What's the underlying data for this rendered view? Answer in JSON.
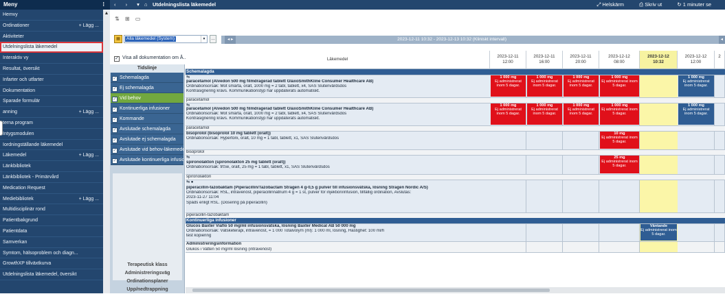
{
  "sidebar": {
    "header": "Meny",
    "items": [
      {
        "label": "Hemvy",
        "add": ""
      },
      {
        "label": "Ordinationer",
        "add": "+ Lägg ..."
      },
      {
        "label": "Aktiviteter",
        "add": ""
      },
      {
        "label": "Utdelningslista läkemedel",
        "add": ""
      },
      {
        "label": "Interaktiv vy",
        "add": ""
      },
      {
        "label": "Resultat, översikt",
        "add": ""
      },
      {
        "label": "Infarter och utfarter",
        "add": ""
      },
      {
        "label": "Dokumentation",
        "add": ""
      },
      {
        "label": "Sparade formulär",
        "add": ""
      },
      {
        "label": "anning",
        "add": "+ Lägg ..."
      },
      {
        "label": "terna program",
        "add": ""
      },
      {
        "label": "Intygsmodulen",
        "add": ""
      },
      {
        "label": "Iordningställande läkemedel",
        "add": ""
      },
      {
        "label": "Läkemedel",
        "add": "+ Lägg ..."
      },
      {
        "label": "Länkbibliotek",
        "add": ""
      },
      {
        "label": "Länkbibliotek - Primärvård",
        "add": ""
      },
      {
        "label": "Medication Request",
        "add": ""
      },
      {
        "label": "Mediebibliotek",
        "add": "+ Lägg ..."
      },
      {
        "label": "Multidisciplinär rond",
        "add": ""
      },
      {
        "label": "Patientbakgrund",
        "add": ""
      },
      {
        "label": "Patientdata",
        "add": ""
      },
      {
        "label": "Samverkan",
        "add": ""
      },
      {
        "label": "Symtom, hälsoproblem och diagn...",
        "add": ""
      },
      {
        "label": "GrowthXP tillväxtkurva",
        "add": ""
      },
      {
        "label": "Utdelningslista läkemedel, översikt",
        "add": ""
      }
    ]
  },
  "topbar": {
    "title": "Utdelningslista läkemedel",
    "fullscreen": "Helskärm",
    "print": "Skriv ut",
    "refresh": "1 minuter se"
  },
  "filter": {
    "selected": "Alla läkemedel (System)",
    "interval": "2023-12-11 10:32 - 2023-12-13 10:32 (Kliniskt intervall)"
  },
  "visa_all": "Visa all dokumentation om Å...",
  "categories": {
    "header": "Tidslinje",
    "items": [
      "Schemalagda",
      "Ej schemalagda",
      "Vid behov",
      "Kontinuerliga infusioner",
      "Kommande",
      "Avslutade schemalagda",
      "Avslutade ej schemalagda",
      "Avslutade vid behov-läkemede",
      "Avslutade kontinuerliga infusio"
    ],
    "bottom": [
      "Terapeutisk klass",
      "Administreringsväg",
      "Ordinationsplaner",
      "Upp/nedtrappning"
    ]
  },
  "table": {
    "col_header": "Läkemedel",
    "times": [
      {
        "date": "2023-12-11",
        "time": "12:00"
      },
      {
        "date": "2023-12-11",
        "time": "16:00"
      },
      {
        "date": "2023-12-11",
        "time": "20:00"
      },
      {
        "date": "2023-12-12",
        "time": "08:00"
      },
      {
        "date": "2023-12-12",
        "time": "10:32"
      },
      {
        "date": "2023-12-12",
        "time": "12:00"
      },
      {
        "date": "2",
        "time": ""
      }
    ],
    "groups": {
      "scheduled": "Schemalagda",
      "infusions": "Kontinuerliga infusioner"
    },
    "meds": {
      "m1": {
        "name": "paracetamol (Alvedon 500 mg filmdragerad tablett GlaxoSmithKline Consumer Healthcare AB)",
        "reason": "Ordinationsorsak: Mot smärta, oralt, 1000 mg = 2 tabl, tablett, x4, SÄS Slutenvårdsdos",
        "note": "Kontrasignering krävs. Kommunikationstyp har uppdaterats automatiskt.",
        "generic": "paracetamol"
      },
      "m2": {
        "name": "paracetamol (Alvedon 500 mg filmdragerad tablett GlaxoSmithKline Consumer Healthcare AB)",
        "reason": "Ordinationsorsak: Mot smärta, oralt, 1000 mg = 2 tabl, tablett, x4, SÄS Slutenvårdsdos",
        "note": "Kontrasignering krävs. Kommunikationstyp har uppdaterats automatiskt.",
        "generic": "paracetamol"
      },
      "m3": {
        "name": "bisoprolol (bisoprolol 10 mg tablett (oralt))",
        "reason": "Ordinationsorsak: Hypertoni, oralt, 10 mg = 1 tabl, tablett, x1, SÄS Slutenvårdsdos",
        "generic": "bisoprolol"
      },
      "m4": {
        "name": "spironolakton (spironolakton 25 mg tablett (oralt))",
        "reason": "Ordinationsorsak: trtSe, oralt, 25 mg = 1 tabl, tablett, x1, SÄS Slutenvårdsdos",
        "generic": "spironolakton"
      },
      "m5": {
        "name": "piperacillin-tazobaktam (Piperacillin/Tazobactam Stragen 4 g-0,5 g pulver till infusionsvätska, lösning Stragen Nordic A/S)",
        "reason": "Ordinationsorsak: RSL, intravenöst, piperacillinnatrium 4 g = 1 st, pulver för injektion/infusion, tillfällig ordination, Avslutas:",
        "date": "2023-11-27 11:04",
        "note": "Spädś enligt RSL. (Dosering på piperacillin)",
        "generic": "piperacillin-tazobaktam"
      },
      "m6": {
        "name": "Glucos Baxter Viaflo 50 mg/ml infusionsvätska, lösning Baxter Medical AB 50 000 mg",
        "reason": "Ordinationsorsak: Vätsketerapi, intravenöst, = 1 000 Totalvolym (ml): 1 000 ml, lösning, Hastighet: 100 ml/h",
        "note": "test kopiering",
        "admin_header": "Administreringsinformation",
        "admin_info": "Glukos i Vatten 50 mg/ml lösning (intravenöst)"
      }
    },
    "dose_labels": {
      "d1000": "1 000 mg",
      "d10": "10 mg",
      "d25": "25 mg",
      "not_given": "Ej administrerat inom 5 dagar.",
      "waiting": "Väntande"
    }
  },
  "colors": {
    "sidebar": "#23466e",
    "accent_red": "#e0101a",
    "current_col": "#f7f3a1",
    "selected_outline": "#d9343a"
  }
}
